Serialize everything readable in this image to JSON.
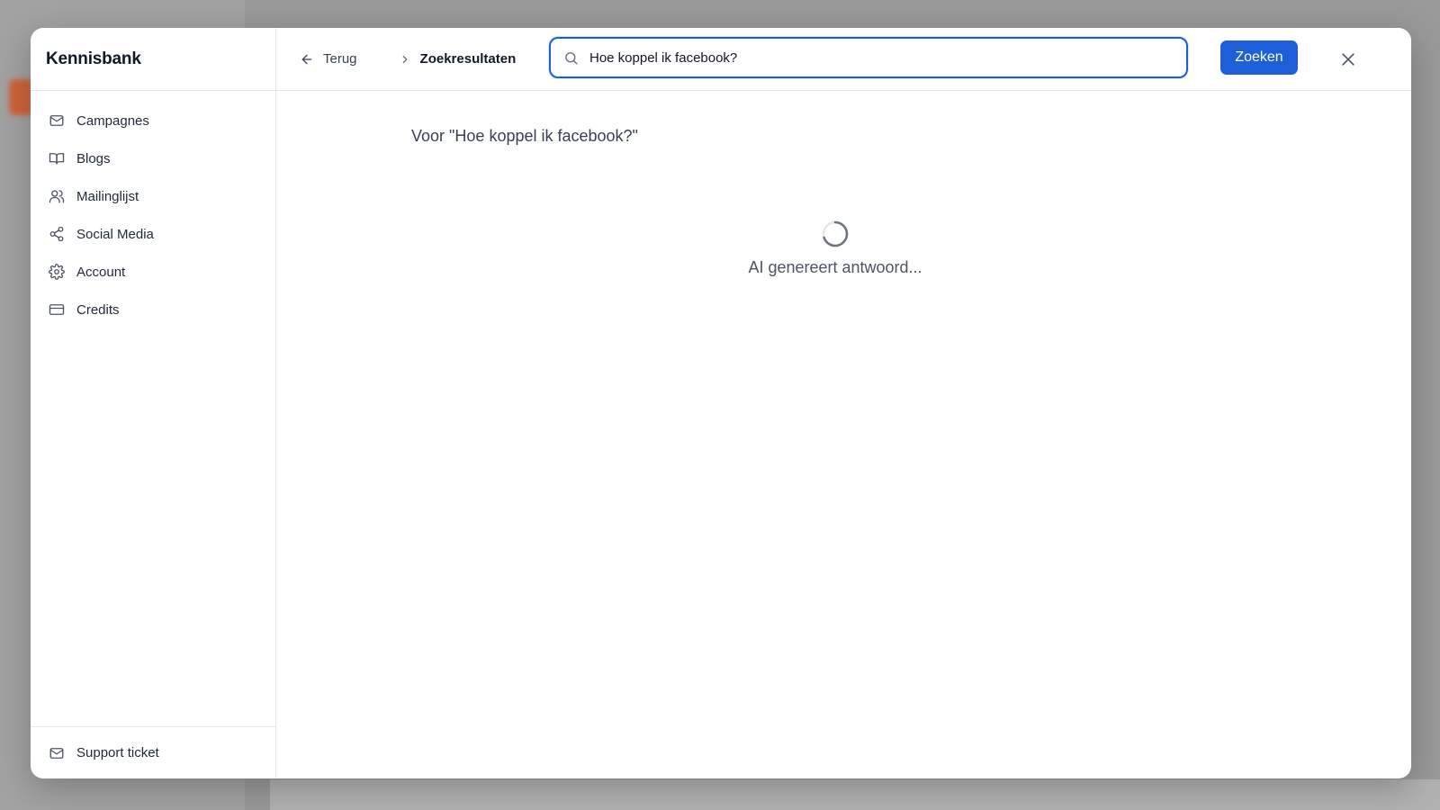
{
  "sidebar": {
    "title": "Kennisbank",
    "items": [
      {
        "label": "Campagnes",
        "icon": "mail-icon"
      },
      {
        "label": "Blogs",
        "icon": "book-icon"
      },
      {
        "label": "Mailinglijst",
        "icon": "users-icon"
      },
      {
        "label": "Social Media",
        "icon": "share-icon"
      },
      {
        "label": "Account",
        "icon": "gear-icon"
      },
      {
        "label": "Credits",
        "icon": "credit-card-icon"
      }
    ],
    "footer": {
      "label": "Support ticket",
      "icon": "mail-icon"
    }
  },
  "topbar": {
    "back_label": "Terug",
    "breadcrumb": "Zoekresultaten",
    "search_value": "Hoe koppel ik facebook?",
    "search_button": "Zoeken"
  },
  "content": {
    "results_for": "Voor \"Hoe koppel ik facebook?\"",
    "loading_text": "AI genereert antwoord..."
  },
  "colors": {
    "accent": "#1d5fd8",
    "border": "#e5e7eb"
  }
}
